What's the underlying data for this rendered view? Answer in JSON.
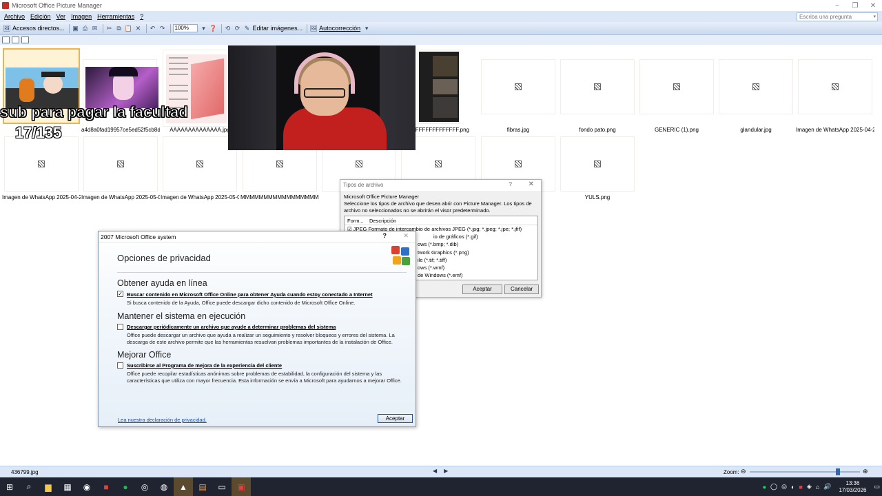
{
  "window": {
    "title": "Microsoft Office Picture Manager",
    "controls": [
      "−",
      "❐",
      "✕"
    ]
  },
  "menu": [
    "Archivo",
    "Edición",
    "Ver",
    "Imagen",
    "Herramientas",
    "?"
  ],
  "ask_box": {
    "placeholder": "Escriba una pregunta"
  },
  "toolbar": {
    "shortcuts": "Accesos directos...",
    "zoom": "100%",
    "edit_images": "Editar imágenes...",
    "autocorrect": "Autocorrección"
  },
  "thumbnails_row1": [
    {
      "caption": "",
      "kind": "image-cartoon"
    },
    {
      "caption": "a4d8a0fad19957ce5ed52f5cb8d...",
      "kind": "image-anime"
    },
    {
      "caption": "AAAAAAAAAAAAAA.jpg",
      "kind": "image-diagram"
    },
    {
      "caption": "",
      "kind": "hidden"
    },
    {
      "caption": "",
      "kind": "hidden"
    },
    {
      "caption": "FFFFFFFFFFFFFFF.png",
      "kind": "image-screenshot"
    },
    {
      "caption": "fibras.jpg",
      "kind": "broken"
    },
    {
      "caption": "fondo pato.png",
      "kind": "broken"
    },
    {
      "caption": "GENERIC (1).png",
      "kind": "broken"
    },
    {
      "caption": "glandular.jpg",
      "kind": "broken"
    },
    {
      "caption": "Imagen de WhatsApp 2025-04-2...",
      "kind": "broken"
    }
  ],
  "thumbnails_row2": [
    {
      "caption": "Imagen de WhatsApp 2025-04-2..."
    },
    {
      "caption": "Imagen de WhatsApp 2025-05-0..."
    },
    {
      "caption": "Imagen de WhatsApp 2025-05-0..."
    },
    {
      "caption": "MMMMMMMMMMMMMMMMMM...."
    },
    {
      "caption": ""
    },
    {
      "caption": ""
    },
    {
      "caption": ""
    },
    {
      "caption": "YULS.png"
    }
  ],
  "overlay": {
    "line1": "sub para pagar la facultad",
    "line2": "17/135"
  },
  "filetypes_dialog": {
    "title": "Tipos de archivo",
    "help": "?",
    "close": "✕",
    "product": "Microsoft Office Picture Manager",
    "description": "Seleccione los tipos de archivo que desea abrir con Picture Manager. Los tipos de archivo no seleccionados no se abrirán el visor predeterminado.",
    "col_format": "Form...",
    "col_desc": "Descripción",
    "rows": [
      "☑ JPEG  Formato de intercambio de archivos JPEG (*.jpg; *.jpeg; *.jpe; *.jfif)",
      "io de gráficos (*.gif)",
      "ows (*.bmp; *.dib)",
      "twork Graphics (*.png)",
      "ile (*.tif; *.tiff)",
      "ows (*.wmf)",
      "de Windows (*.emf)"
    ],
    "ok": "Aceptar",
    "cancel": "Cancelar"
  },
  "privacy_dialog": {
    "title": "2007 Microsoft Office system",
    "help": "?",
    "close": "✕",
    "heading": "Opciones de privacidad",
    "s1_title": "Obtener ayuda en línea",
    "s1_opt": "Buscar contenido en Microsoft Office Online para obtener Ayuda cuando estoy conectado a Internet",
    "s1_desc": "Si busca contenido de la Ayuda, Office puede descargar dicho contenido de Microsoft Office Online.",
    "s1_checked": true,
    "s2_title": "Mantener el sistema en ejecución",
    "s2_opt": "Descargar periódicamente un archivo que ayude a determinar problemas del sistema",
    "s2_desc": "Office puede descargar un archivo que ayuda a realizar un seguimiento y resolver bloqueos y errores del sistema. La descarga de este archivo permite que las herramientas resuelvan problemas importantes de la instalación de Office.",
    "s2_checked": false,
    "s3_title": "Mejorar Office",
    "s3_opt": "Suscribirse al Programa de mejora de la experiencia del cliente",
    "s3_desc": "Office puede recopilar estadísticas anónimas sobre problemas de estabilidad, la configuración del sistema y las características que utiliza con mayor frecuencia. Esta información se envía a Microsoft para ayudarnos a mejorar Office.",
    "s3_checked": false,
    "link": "Lea nuestra declaración de privacidad.",
    "ok": "Aceptar"
  },
  "statusbar": {
    "filename": "436799.jpg",
    "zoom_label": "Zoom:",
    "zoom_level": 0.8
  },
  "taskbar": {
    "time": "13:36",
    "date": "17/03/2026"
  }
}
